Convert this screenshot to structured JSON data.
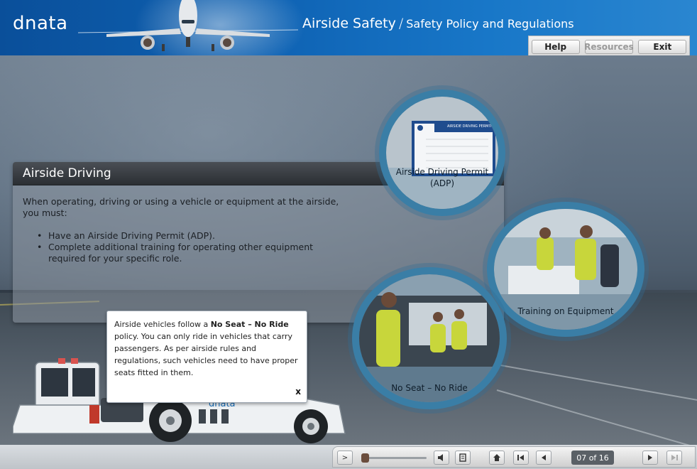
{
  "header": {
    "logo": "dnata",
    "course_title": "Airside Safety",
    "separator": "/",
    "module_title": "Safety Policy and Regulations"
  },
  "top_buttons": {
    "help": "Help",
    "resources": "Resources",
    "exit": "Exit"
  },
  "panel": {
    "title": "Airside Driving",
    "intro": "When operating, driving or using a vehicle or equipment at the airside, you must:",
    "bullets": [
      "Have an Airside Driving Permit (ADP).",
      "Complete additional training for operating other equipment required for your specific role."
    ]
  },
  "circles": {
    "adp": {
      "label": "Airside Driving Permit (ADP)",
      "card_title": "AIRSIDE DRIVING PERMIT"
    },
    "training": {
      "label": "Training on Equipment"
    },
    "noseat": {
      "label": "No Seat – No Ride"
    }
  },
  "callout": {
    "text_before": "Airside vehicles follow a ",
    "bold": "No Seat – No Ride",
    "text_after": " policy. You can only ride in vehicles that carry passengers. As per airside rules and regulations, such vehicles need to have proper seats fitted in them.",
    "close": "x"
  },
  "truck": {
    "brand": "dnata"
  },
  "nav": {
    "play": ">",
    "page_counter": "07 of 16",
    "progress_fraction": 0.0
  },
  "colors": {
    "header_blue": "#0f63b4",
    "circle_ring": "#3a7ea6",
    "panel_title_bar": "#2b2f33"
  }
}
